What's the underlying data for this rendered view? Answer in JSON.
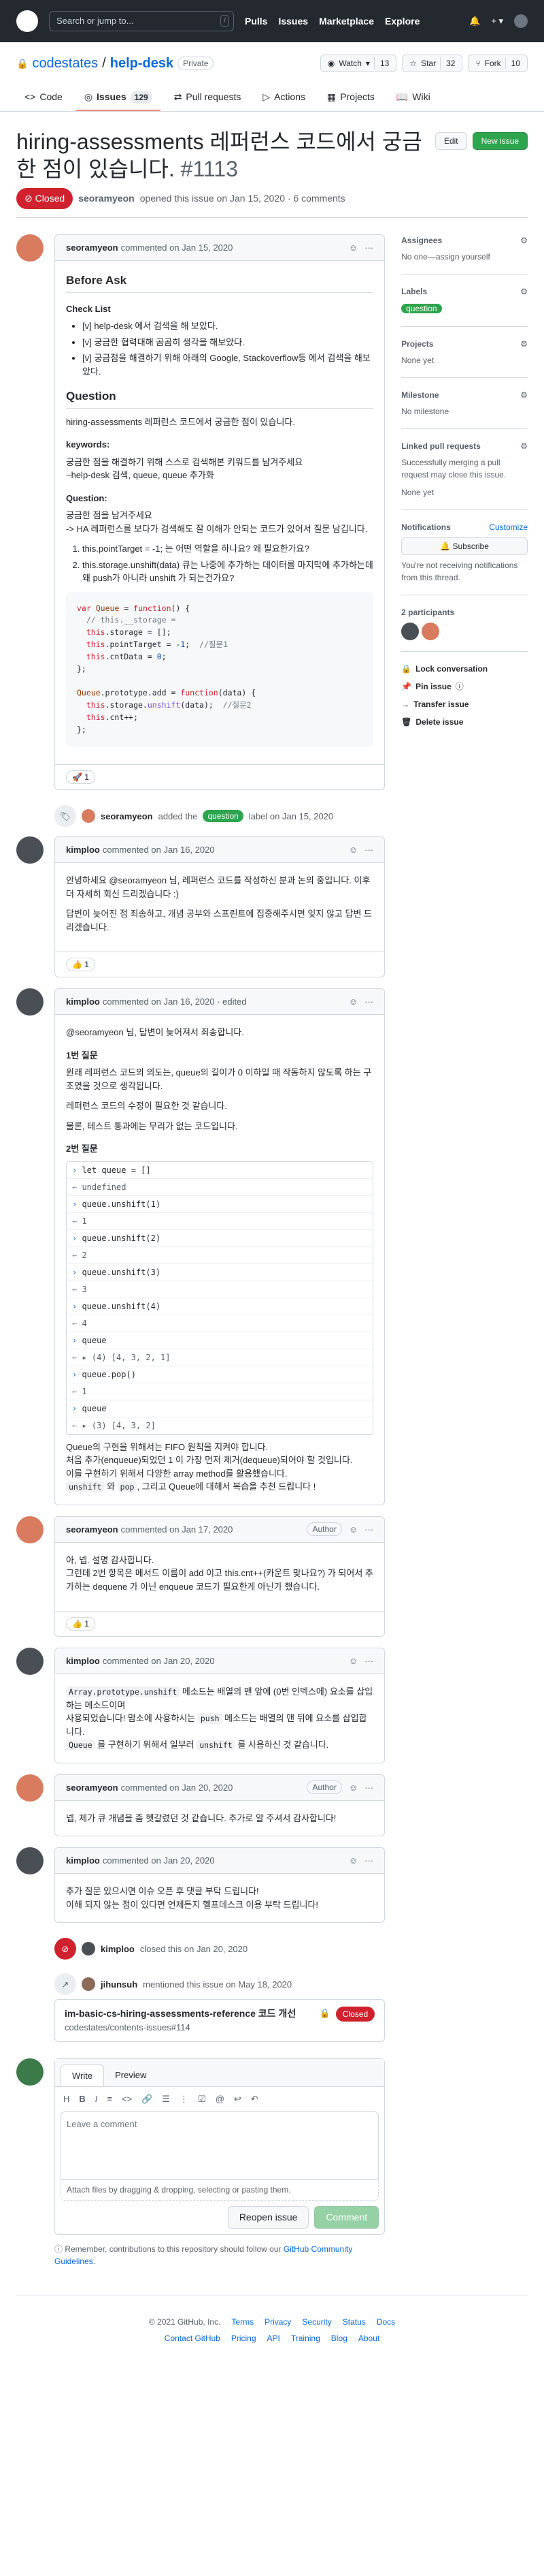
{
  "header": {
    "search_placeholder": "Search or jump to...",
    "search_key": "/",
    "nav": [
      "Pulls",
      "Issues",
      "Marketplace",
      "Explore"
    ]
  },
  "repo": {
    "owner": "codestates",
    "sep": "/",
    "name": "help-desk",
    "visibility": "Private",
    "watch_label": "Watch",
    "watch_count": "13",
    "star_label": "Star",
    "star_count": "32",
    "fork_label": "Fork",
    "fork_count": "10",
    "tabs": [
      {
        "label": "Code"
      },
      {
        "label": "Issues",
        "count": "129"
      },
      {
        "label": "Pull requests"
      },
      {
        "label": "Actions"
      },
      {
        "label": "Projects"
      },
      {
        "label": "Wiki"
      }
    ]
  },
  "issue": {
    "title": "hiring-assessments 레퍼런스 코드에서 궁금한 점이 있습니다.",
    "number": "#1113",
    "edit_label": "Edit",
    "new_issue_label": "New issue",
    "state": "Closed",
    "author": "seoramyeon",
    "meta_text": "opened this issue on Jan 15, 2020 · 6 comments"
  },
  "comments": {
    "c1": {
      "author": "seoramyeon",
      "time": "commented on Jan 15, 2020",
      "h_before": "Before Ask",
      "h_check": "Check List",
      "checks": [
        "[v] help-desk 에서 검색을 해 보았다.",
        "[v] 궁금한 협력대해 곰곰히 생각을 해보았다.",
        "[v] 궁금점을 해결하기 위해 아래의 Google, Stackoverflow등 에서 검색을 해보았다."
      ],
      "h_question": "Question",
      "q_text": "hiring-assessments 레퍼런스 코드에서 궁금한 점이 있습니다.",
      "h_keywords": "keywords:",
      "kw_text1": "궁금한 점을 해결하기 위해 스스로 검색해본 키워드를 남겨주세요",
      "kw_text2": "~help-desk 검색, queue, queue 추가화",
      "h_q2": "Question:",
      "q2_text1": "궁금한 점을 남겨주세요",
      "q2_text2": "-> HA 레퍼런스를 보다가 검색해도 잘 이해가 안되는 코드가 있어서 질문 남깁니다.",
      "items": [
        "this.pointTarget = -1; 는 어떤 역할을 하나요? 왜 필요한가요?",
        "this.storage.unshift(data) 큐는 나중에 추가하는 데이터를 마지막에 추가하는데 왜 push가 아니라 unshift 가 되는건가요?"
      ],
      "reaction": "🚀 1"
    },
    "label_event": {
      "actor": "seoramyeon",
      "pre": "added the",
      "label": "question",
      "post": "label on Jan 15, 2020"
    },
    "c2": {
      "author": "kimploo",
      "time": "commented on Jan 16, 2020",
      "p1": "안녕하세요 @seoramyeon 님, 레퍼런스 코드를 작성하신 분과 논의 중입니다. 이후 더 자세히 회신 드리겠습니다 :)",
      "p2": "답변이 늦어진 점 죄송하고, 개념 공부와 스프린트에 집중해주시면 잊지 않고 답변 드리겠습니다.",
      "reaction": "👍 1"
    },
    "c3": {
      "author": "kimploo",
      "time": "commented on Jan 16, 2020 · edited",
      "p_intro": "@seoramyeon 님, 답변이 늦어져서 죄송합니다.",
      "h1": "1번 질문",
      "p1a": "원래 레퍼런스 코드의 의도는, queue의 길이가 0 이하일 때 작동하지 않도록 하는 구조였을 것으로 생각됩니다.",
      "p1b": "레퍼런스 코드의 수정이 필요한 것 같습니다.",
      "p1c": "물론, 테스트 통과에는 무리가 없는 코드입니다.",
      "h2": "2번 질문",
      "console": [
        {
          "t": "in",
          "v": "let queue = []"
        },
        {
          "t": "out",
          "v": "undefined"
        },
        {
          "t": "in",
          "v": "queue.unshift(1)"
        },
        {
          "t": "out",
          "v": "1"
        },
        {
          "t": "in",
          "v": "queue.unshift(2)"
        },
        {
          "t": "out",
          "v": "2"
        },
        {
          "t": "in",
          "v": "queue.unshift(3)"
        },
        {
          "t": "out",
          "v": "3"
        },
        {
          "t": "in",
          "v": "queue.unshift(4)"
        },
        {
          "t": "out",
          "v": "4"
        },
        {
          "t": "in",
          "v": "queue"
        },
        {
          "t": "out",
          "v": "▸ (4) [4, 3, 2, 1]"
        },
        {
          "t": "in",
          "v": "queue.pop()"
        },
        {
          "t": "out",
          "v": "1"
        },
        {
          "t": "in",
          "v": "queue"
        },
        {
          "t": "out",
          "v": "▸ (3) [4, 3, 2]"
        }
      ],
      "p2a": "Queue의 구현을 위해서는 FIFO 원칙을 지켜야 합니다.",
      "p2b": "처음 추가(enqueue)되었던 1 이 가장 먼저 제거(dequeue)되어야 할 것입니다.",
      "p2c": "이를 구현하기 위해서 다양한 array method를 활용했습니다.",
      "p2d_code1": "unshift",
      "p2d_mid": " 와 ",
      "p2d_code2": "pop",
      "p2d_rest": ", 그리고 Queue에 대해서 복습을 추천 드립니다 !"
    },
    "c4": {
      "author": "seoramyeon",
      "time": "commented on Jan 17, 2020",
      "role": "Author",
      "p1": "아, 넵. 설명 감사합니다.",
      "p2": "그런데 2번 항목은 메서드 이름이 add 이고 this.cnt++(카운트 맞나요?) 가 되어서 추가하는 dequene 가 아닌 enqueue 코드가 필요한게 아닌가 했습니다.",
      "reaction": "👍 1"
    },
    "c5": {
      "author": "kimploo",
      "time": "commented on Jan 20, 2020",
      "code1": "Array.prototype.unshift",
      "t1": " 메소드는 배열의 맨 앞에 (0번 인덱스에) 요소를 삽입하는 메소드이며",
      "t2a": "사용되었습니다! 맘소에 사용하시는 ",
      "code2": "push",
      "t2b": " 메소드는 배열의 맨 뒤에 요소를 삽입합니다.",
      "code3": "Queue",
      "t3a": " 를 구현하기 위해서 일부러 ",
      "code4": "unshift",
      "t3b": " 를 사용하신 것 같습니다."
    },
    "c6": {
      "author": "seoramyeon",
      "time": "commented on Jan 20, 2020",
      "role": "Author",
      "p1": "넵, 제가 큐 개념을 좀 헷갈렸던 것 같습니다. 추가로 알 주셔서 감사합니다!"
    },
    "c7": {
      "author": "kimploo",
      "time": "commented on Jan 20, 2020",
      "p1": "추가 질문 있으시면 이슈 오픈 후 댓글 부탁 드립니다!",
      "p2": "이해 되지 않는 점이 있다면 언제든지 헬프데스크 이용 부탁 드립니다!"
    },
    "close_event": {
      "actor": "kimploo",
      "text": "closed this on Jan 20, 2020"
    },
    "mention_event": {
      "actor": "jihunsuh",
      "text": "mentioned this issue on May 18, 2020",
      "ref_title": "im-basic-cs-hiring-assessments-reference 코드 개선",
      "ref_repo": "codestates/contents-issues#114",
      "ref_state": "Closed"
    }
  },
  "editor": {
    "tab_write": "Write",
    "tab_preview": "Preview",
    "toolbar": [
      "H",
      "B",
      "I",
      "≡",
      "<>",
      "🔗",
      "☰",
      "⋮",
      "☑",
      "@",
      "↩",
      "↶"
    ],
    "placeholder": "Leave a comment",
    "attach": "Attach files by dragging & dropping, selecting or pasting them.",
    "reopen_label": "Reopen issue",
    "comment_label": "Comment",
    "notice_pre": "Remember, contributions to this repository should follow our",
    "notice_link": "GitHub Community Guidelines."
  },
  "sidebar": {
    "assignees_h": "Assignees",
    "assignees_v": "No one—assign yourself",
    "labels_h": "Labels",
    "labels_v": "question",
    "projects_h": "Projects",
    "projects_v": "None yet",
    "milestone_h": "Milestone",
    "milestone_v": "No milestone",
    "linked_h": "Linked pull requests",
    "linked_v1": "Successfully merging a pull request may close this issue.",
    "linked_v2": "None yet",
    "notif_h": "Notifications",
    "notif_customize": "Customize",
    "subscribe_label": "Subscribe",
    "notif_v": "You're not receiving notifications from this thread.",
    "participants_h": "2 participants",
    "lock": "Lock conversation",
    "pin": "Pin issue",
    "transfer": "Transfer issue",
    "delete": "Delete issue"
  },
  "footer": {
    "copyright": "© 2021 GitHub, Inc.",
    "links": [
      "Terms",
      "Privacy",
      "Security",
      "Status",
      "Docs",
      "Contact GitHub",
      "Pricing",
      "API",
      "Training",
      "Blog",
      "About"
    ]
  },
  "colors": {
    "accent": "#0969da",
    "closed": "#cf222e",
    "green": "#2da44e",
    "header_bg": "#24292f"
  }
}
